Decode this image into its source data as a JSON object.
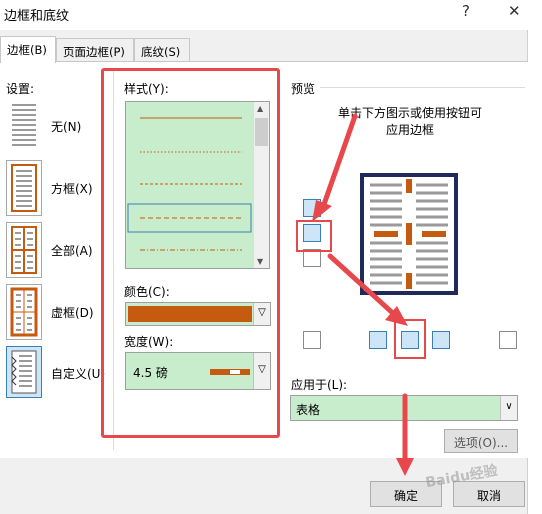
{
  "window": {
    "title": "边框和底纹",
    "help": "?",
    "close": "✕"
  },
  "tabs": [
    "边框(B)",
    "页面边框(P)",
    "底纹(S)"
  ],
  "settings": {
    "heading": "设置:",
    "items": [
      {
        "label": "无(N)"
      },
      {
        "label": "方框(X)"
      },
      {
        "label": "全部(A)"
      },
      {
        "label": "虚框(D)"
      },
      {
        "label": "自定义(U)"
      }
    ]
  },
  "style": {
    "label": "样式(Y):"
  },
  "color": {
    "label": "颜色(C):",
    "value_color": "#c55a11"
  },
  "width": {
    "label": "宽度(W):",
    "value": "4.5 磅"
  },
  "preview": {
    "heading": "预览",
    "hint_line1": "单击下方图示或使用按钮可",
    "hint_line2": "应用边框"
  },
  "apply_to": {
    "label": "应用于(L):",
    "value": "表格"
  },
  "buttons": {
    "options": "选项(O)...",
    "ok": "确定",
    "cancel": "取消"
  },
  "watermark": "Baidu经验",
  "colors": {
    "accent": "#c55a11",
    "highlight": "#e8474b",
    "eye_care_bg": "#c7edcc",
    "selection": "#cde6f7"
  }
}
